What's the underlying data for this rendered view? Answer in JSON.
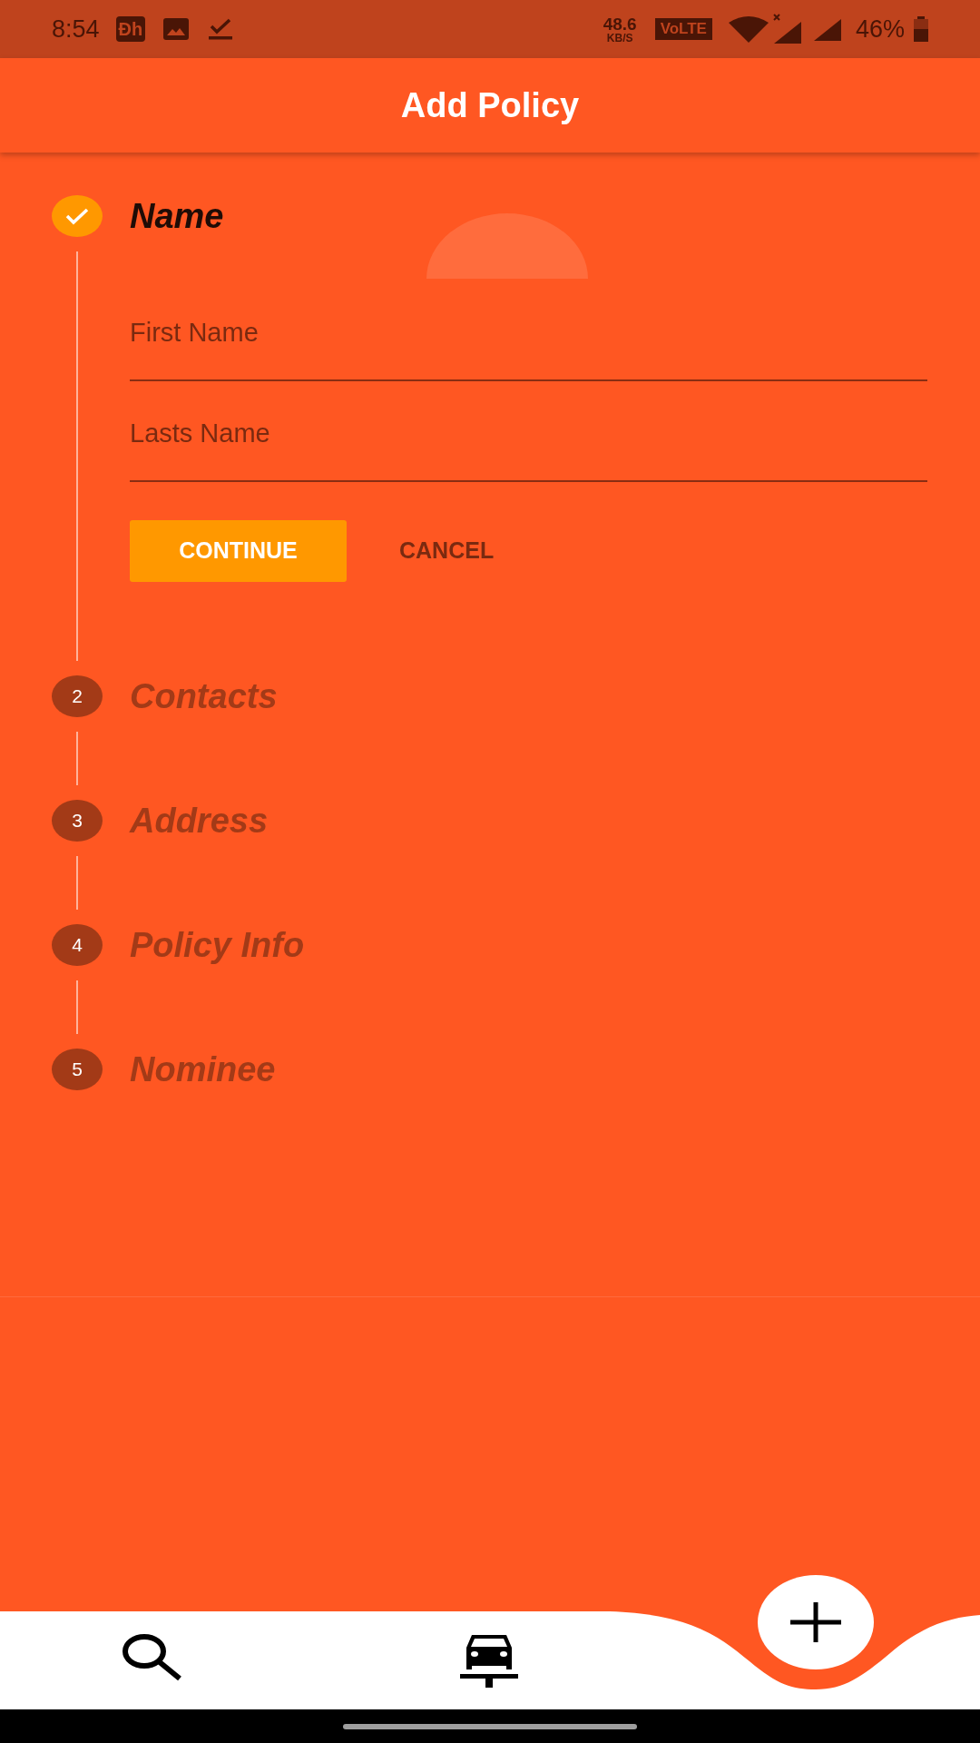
{
  "status_bar": {
    "time": "8:54",
    "app_badge": "Ɖh",
    "speed": "48.6",
    "speed_unit": "KB/S",
    "volte": "VoLTE",
    "battery": "46%"
  },
  "app_bar": {
    "title": "Add Policy"
  },
  "steps": [
    {
      "title": "Name",
      "completed": true,
      "selected": true,
      "fields": [
        {
          "placeholder": "First Name"
        },
        {
          "placeholder": "Lasts Name"
        }
      ],
      "buttons": [
        {
          "label": "CONTINUE",
          "kind": "primary"
        },
        {
          "label": "CANCEL",
          "kind": "text"
        }
      ]
    },
    {
      "number": "2",
      "title": "Contacts",
      "completed": false,
      "selected": false
    },
    {
      "number": "3",
      "title": "Address",
      "completed": false,
      "selected": false
    },
    {
      "number": "4",
      "title": "Policy Info",
      "completed": false,
      "selected": false
    },
    {
      "number": "5",
      "title": "Nominee",
      "completed": false,
      "selected": false
    }
  ],
  "bottom_nav": {
    "items": [
      {
        "kind": "search"
      },
      {
        "kind": "car"
      }
    ],
    "fab": {
      "kind": "add"
    }
  }
}
